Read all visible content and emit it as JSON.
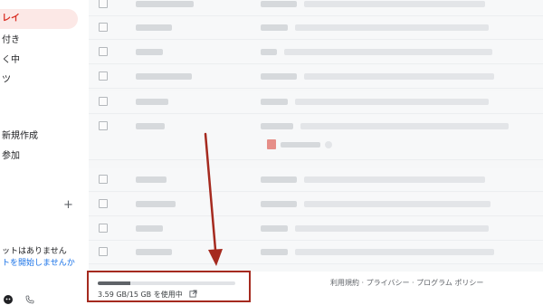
{
  "sidebar": {
    "items": [
      {
        "label": "レイ",
        "active": true
      },
      {
        "label": "付き"
      },
      {
        "label": "く中"
      },
      {
        "label": "ツ"
      },
      {
        "label": "新規作成"
      },
      {
        "label": "参加"
      }
    ],
    "add_label": "+",
    "hangouts_message": "ットはありません",
    "hangouts_link": "トを開始しませんか"
  },
  "storage": {
    "text": "3.59 GB/15 GB を使用中",
    "used_fraction": 0.24
  },
  "footer": {
    "links": "利用規約 · プライバシー · プログラム ポリシー"
  },
  "colors": {
    "accent": "#d93025",
    "annotation": "#a52a1f",
    "link": "#1a73e8"
  },
  "icons": {
    "storage": "external-link-icon",
    "chat": "chat-icon",
    "phone": "phone-icon"
  }
}
